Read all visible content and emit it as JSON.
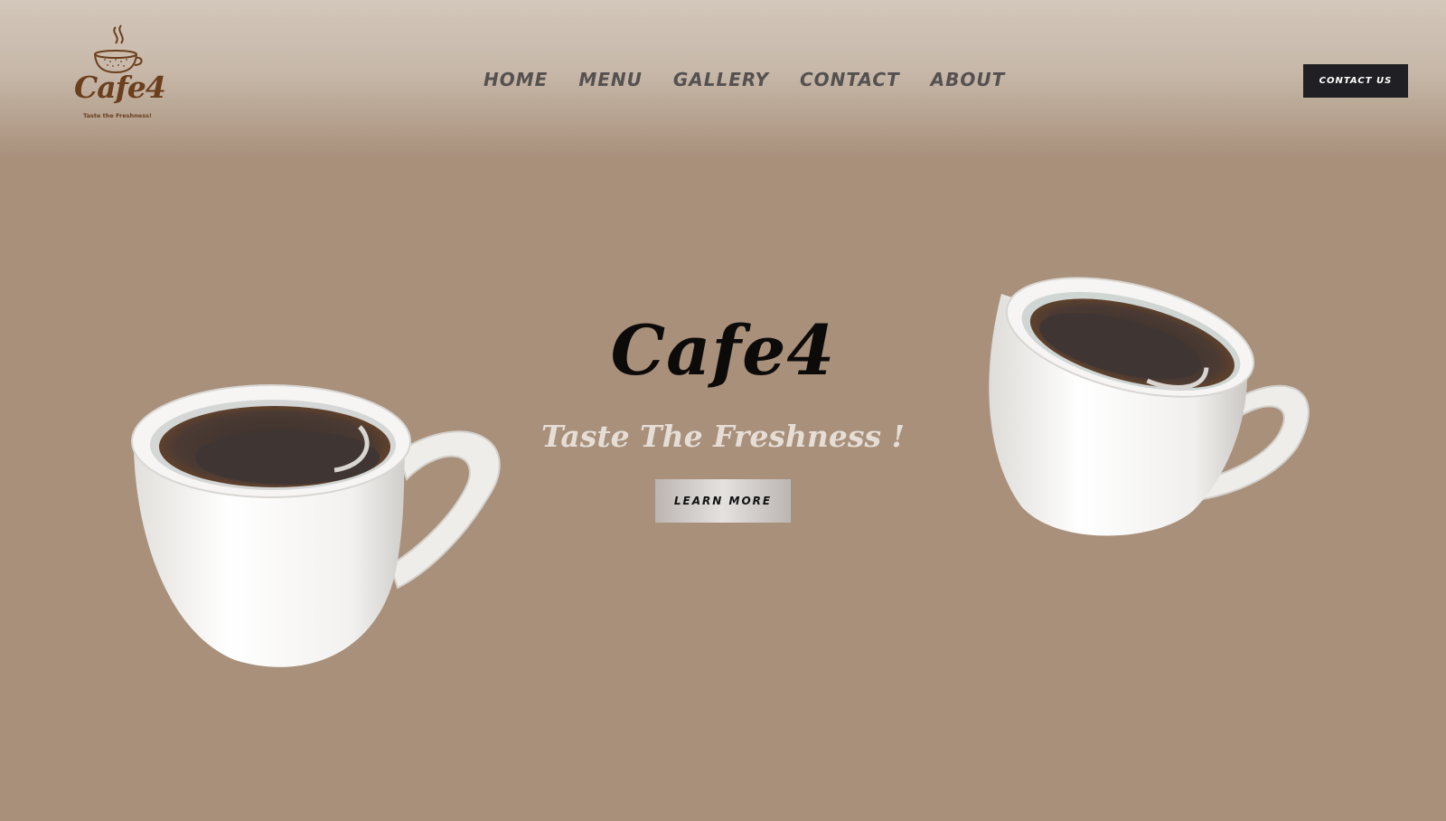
{
  "brand": {
    "logo_text": "Cafe4",
    "logo_tagline": "Taste the Freshness!",
    "logo_color": "#6b3f1d"
  },
  "nav": {
    "items": [
      {
        "label": "HOME"
      },
      {
        "label": "MENU"
      },
      {
        "label": "GALLERY"
      },
      {
        "label": "CONTACT"
      },
      {
        "label": "ABOUT"
      }
    ]
  },
  "header": {
    "cta_label": "CONTACT US"
  },
  "hero": {
    "title": "Cafe4",
    "subtitle": "Taste The Freshness !",
    "button_label": "LEARN MORE"
  },
  "images": {
    "left": "coffee-cup-icon",
    "right": "coffee-cup-icon"
  },
  "colors": {
    "background": "#a8907b",
    "nav_text": "#555151",
    "cta_bg": "#1f1f24",
    "title": "#0d0b0a",
    "subtitle": "#e6ded6"
  }
}
